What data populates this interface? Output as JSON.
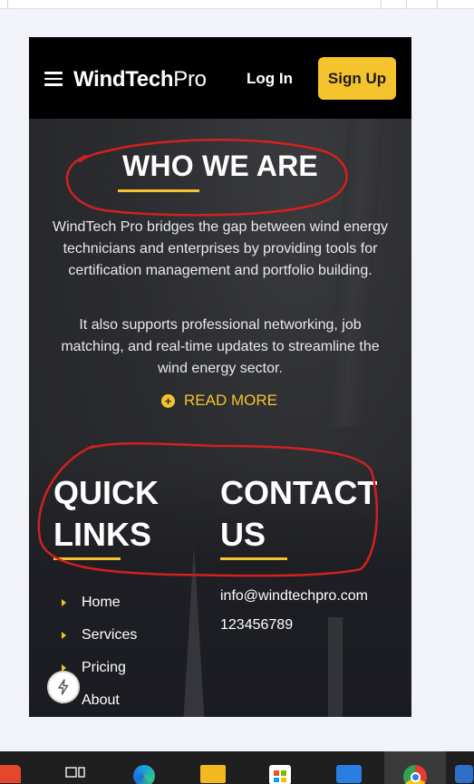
{
  "header": {
    "brand_bold": "WindTech",
    "brand_light": "Pro",
    "login_label": "Log In",
    "signup_label": "Sign Up"
  },
  "about": {
    "title": "WHO WE ARE",
    "paragraph1": "WindTech Pro bridges the gap between wind energy technicians and enterprises by providing tools for certification management and portfolio building.",
    "paragraph2": "It also supports professional networking, job matching, and real-time updates to streamline the wind energy sector.",
    "read_more_label": "READ MORE"
  },
  "quick_links": {
    "title": "QUICK LINKS",
    "items": [
      "Home",
      "Services",
      "Pricing",
      "About"
    ]
  },
  "contact": {
    "title": "CONTACT US",
    "email": "info@windtechpro.com",
    "phone": "123456789"
  },
  "colors": {
    "accent": "#f5c32c",
    "header_bg": "#000000",
    "annotation": "#d42020"
  },
  "icons": [
    "menu-icon",
    "plus-circle-icon",
    "chevron-right-icon",
    "bolt-icon"
  ]
}
